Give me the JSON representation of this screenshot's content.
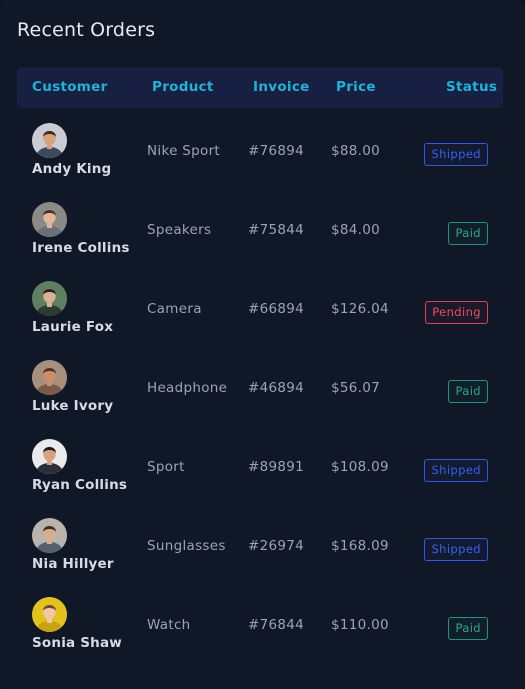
{
  "title": "Recent Orders",
  "columns": {
    "customer": "Customer",
    "product": "Product",
    "invoice": "Invoice",
    "price": "Price",
    "status": "Status"
  },
  "status_colors": {
    "Shipped": "#2f5be0",
    "Paid": "#25937c",
    "Pending": "#d8444f"
  },
  "orders": [
    {
      "customer": "Andy King",
      "product": "Nike Sport",
      "invoice": "#76894",
      "price": "$88.00",
      "status": "Shipped",
      "avatar": "avatar-andy-king"
    },
    {
      "customer": "Irene Collins",
      "product": "Speakers",
      "invoice": "#75844",
      "price": "$84.00",
      "status": "Paid",
      "avatar": "avatar-irene-collins"
    },
    {
      "customer": "Laurie Fox",
      "product": "Camera",
      "invoice": "#66894",
      "price": "$126.04",
      "status": "Pending",
      "avatar": "avatar-laurie-fox"
    },
    {
      "customer": "Luke Ivory",
      "product": "Headphone",
      "invoice": "#46894",
      "price": "$56.07",
      "status": "Paid",
      "avatar": "avatar-luke-ivory"
    },
    {
      "customer": "Ryan Collins",
      "product": "Sport",
      "invoice": "#89891",
      "price": "$108.09",
      "status": "Shipped",
      "avatar": "avatar-ryan-collins"
    },
    {
      "customer": "Nia Hillyer",
      "product": "Sunglasses",
      "invoice": "#26974",
      "price": "$168.09",
      "status": "Shipped",
      "avatar": "avatar-nia-hillyer"
    },
    {
      "customer": "Sonia Shaw",
      "product": "Watch",
      "invoice": "#76844",
      "price": "$110.00",
      "status": "Paid",
      "avatar": "avatar-sonia-shaw"
    }
  ]
}
